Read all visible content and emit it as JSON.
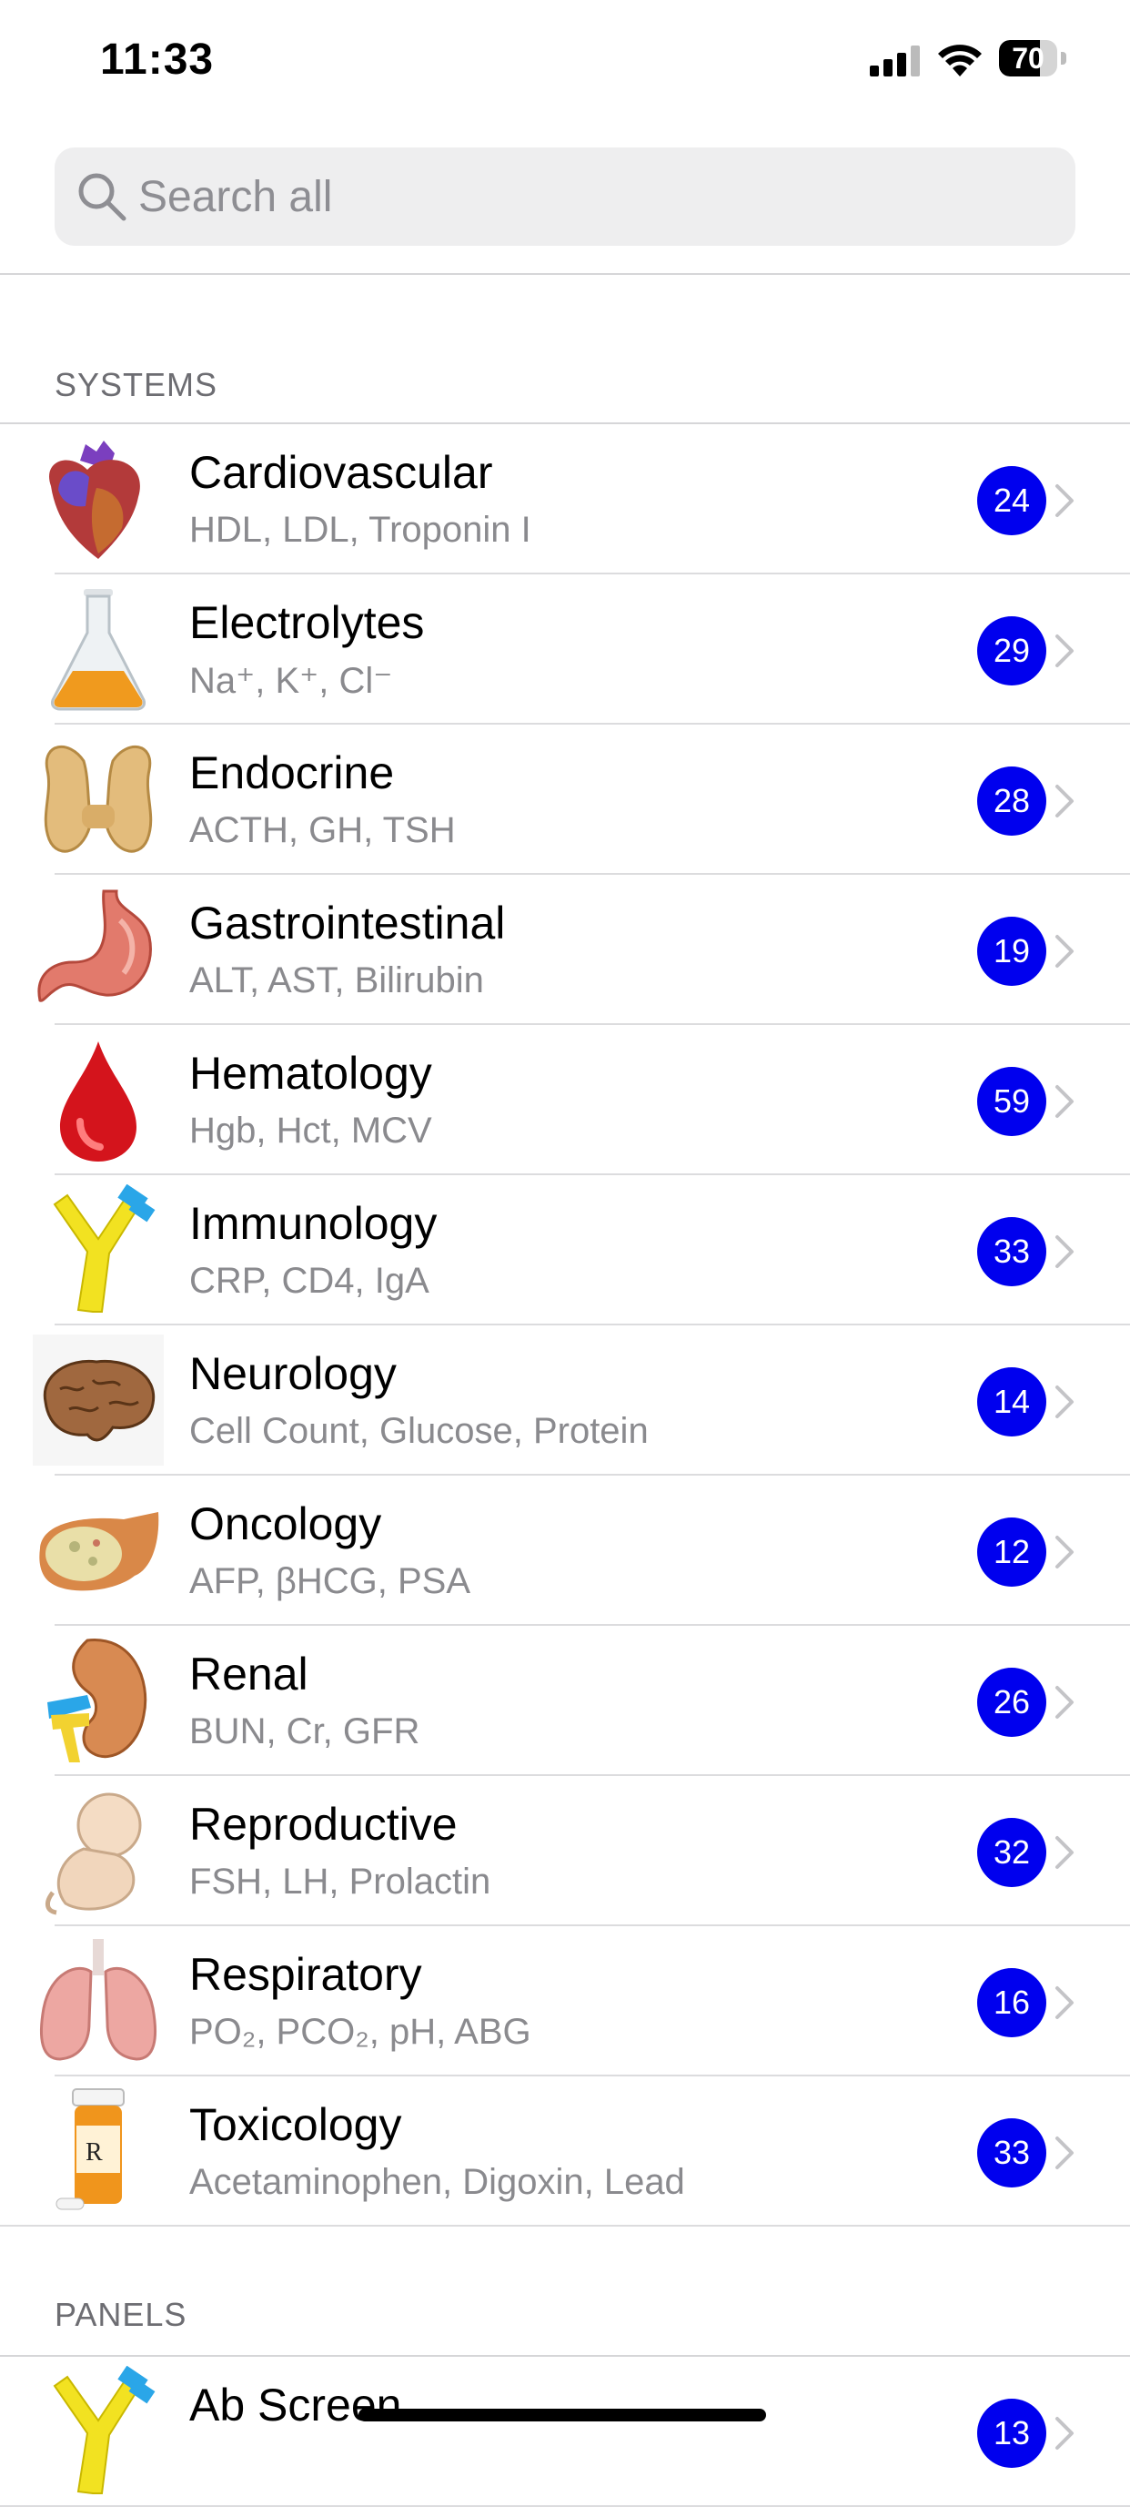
{
  "status_bar": {
    "time": "11:33",
    "battery": "70",
    "battery_level": 0.7
  },
  "search": {
    "placeholder": "Search all",
    "icon": "magnifying-glass-icon"
  },
  "sections": {
    "systems": {
      "header": "SYSTEMS",
      "items": [
        {
          "title": "Cardiovascular",
          "subtitle": "HDL, LDL, Troponin I",
          "count": "24",
          "icon": "heart-icon"
        },
        {
          "title": "Electrolytes",
          "subtitle": "Na⁺, K⁺, Cl⁻",
          "count": "29",
          "icon": "flask-icon"
        },
        {
          "title": "Endocrine",
          "subtitle": "ACTH, GH, TSH",
          "count": "28",
          "icon": "thyroid-icon"
        },
        {
          "title": "Gastrointestinal",
          "subtitle": "ALT, AST, Bilirubin",
          "count": "19",
          "icon": "stomach-icon"
        },
        {
          "title": "Hematology",
          "subtitle": "Hgb, Hct, MCV",
          "count": "59",
          "icon": "blood-drop-icon"
        },
        {
          "title": "Immunology",
          "subtitle": "CRP, CD4, IgA",
          "count": "33",
          "icon": "antibody-icon"
        },
        {
          "title": "Neurology",
          "subtitle": "Cell Count, Glucose, Protein",
          "count": "14",
          "icon": "brain-icon"
        },
        {
          "title": "Oncology",
          "subtitle": "AFP, βHCG, PSA",
          "count": "12",
          "icon": "tumor-tissue-icon"
        },
        {
          "title": "Renal",
          "subtitle": "BUN, Cr, GFR",
          "count": "26",
          "icon": "kidney-icon"
        },
        {
          "title": "Reproductive",
          "subtitle": "FSH, LH, Prolactin",
          "count": "32",
          "icon": "fetus-icon"
        },
        {
          "title": "Respiratory",
          "subtitle": "PO₂, PCO₂, pH, ABG",
          "count": "16",
          "icon": "lungs-icon"
        },
        {
          "title": "Toxicology",
          "subtitle": "Acetaminophen, Digoxin, Lead",
          "count": "33",
          "icon": "pill-bottle-icon"
        }
      ]
    },
    "panels": {
      "header": "PANELS",
      "items": [
        {
          "title": "Ab Screen",
          "subtitle": "",
          "count": "13",
          "icon": "antibody-icon"
        }
      ]
    }
  },
  "colors": {
    "badge": "#0000ee",
    "background": "#ffffff",
    "subtitle": "#8a8a8e",
    "section_header": "#6d6d72"
  }
}
